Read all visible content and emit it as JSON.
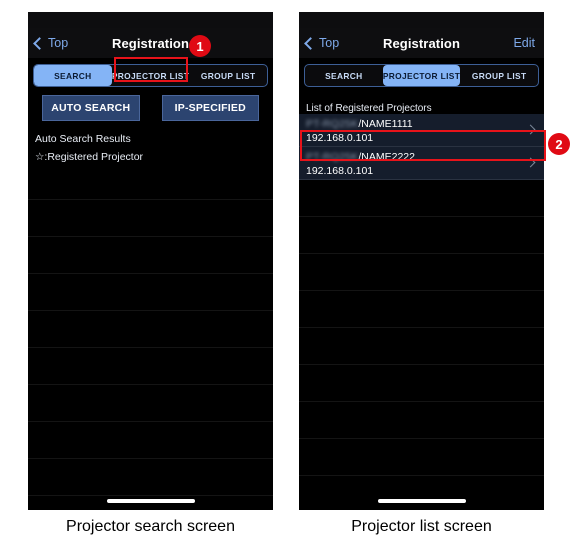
{
  "left_panel": {
    "nav": {
      "back_label": "Top",
      "title": "Registration"
    },
    "segments": [
      {
        "label": "SEARCH",
        "active": true
      },
      {
        "label": "PROJECTOR LIST",
        "active": false
      },
      {
        "label": "GROUP LIST",
        "active": false
      }
    ],
    "buttons": [
      {
        "label": "AUTO SEARCH"
      },
      {
        "label": "IP-SPECIFIED"
      }
    ],
    "results_label": "Auto Search Results",
    "legend_label": "☆:Registered Projector",
    "empty_row_count": 9,
    "caption": "Projector search screen"
  },
  "right_panel": {
    "nav": {
      "back_label": "Top",
      "title": "Registration",
      "edit_label": "Edit"
    },
    "segments": [
      {
        "label": "SEARCH",
        "active": false
      },
      {
        "label": "PROJECTOR LIST",
        "active": true
      },
      {
        "label": "GROUP LIST",
        "active": false
      }
    ],
    "list_header": "List of Registered Projectors",
    "projectors": [
      {
        "model": "PT-RQ25K",
        "name": "/NAME1111",
        "ip": "192.168.0.101"
      },
      {
        "model": "PT-RQ25K",
        "name": "/NAME2222",
        "ip": "192.168.0.101"
      }
    ],
    "empty_row_count": 8,
    "caption": "Projector list screen"
  },
  "annotations": [
    {
      "number": "1",
      "target": "projector-list-tab"
    },
    {
      "number": "2",
      "target": "first-projector-row"
    }
  ],
  "colors": {
    "accent_blue": "#84b4f6",
    "link_blue": "#7ea9ea",
    "annotation_red": "#e00a14",
    "button_navy": "#2c4470",
    "row_navy": "#151d2c"
  }
}
